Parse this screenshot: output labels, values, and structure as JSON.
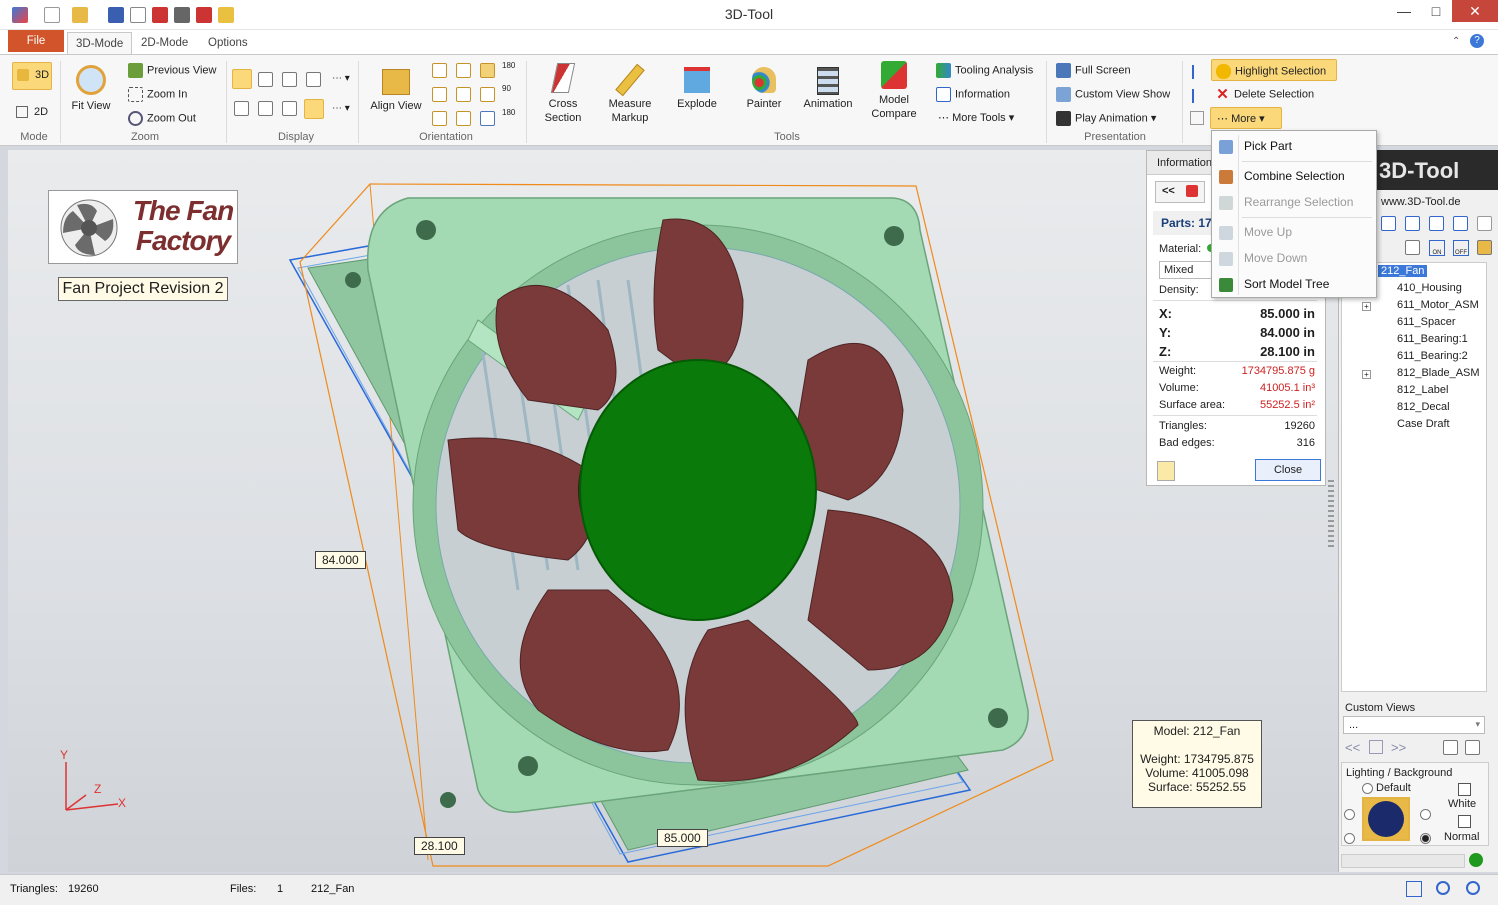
{
  "window": {
    "title": "3D-Tool",
    "min": "—",
    "max": "□",
    "close": "✕"
  },
  "tabs": {
    "file": "File",
    "mode3d": "3D-Mode",
    "mode2d": "2D-Mode",
    "options": "Options"
  },
  "ribbon": {
    "mode": {
      "label": "Mode",
      "btn3d": "3D",
      "btn2d": "2D"
    },
    "zoom": {
      "label": "Zoom",
      "fit_view": "Fit View",
      "previous_view": "Previous View",
      "zoom_in": "Zoom In",
      "zoom_out": "Zoom Out"
    },
    "display": {
      "label": "Display"
    },
    "orientation": {
      "label": "Orientation",
      "align_view": "Align View",
      "rot180a": "180",
      "rot90": "90",
      "rot180b": "180"
    },
    "tools": {
      "label": "Tools",
      "cross_section": "Cross\nSection",
      "cross_section_1": "Cross",
      "cross_section_2": "Section",
      "measure_1": "Measure",
      "measure_2": "Markup",
      "explode": "Explode",
      "painter": "Painter",
      "animation": "Animation",
      "model_compare_1": "Model",
      "model_compare_2": "Compare",
      "tooling_analysis": "Tooling Analysis",
      "information": "Information",
      "more_tools": "More Tools"
    },
    "presentation": {
      "label": "Presentation",
      "full_screen": "Full Screen",
      "custom_view_show": "Custom View Show",
      "play_animation": "Play Animation"
    },
    "selection": {
      "highlight": "Highlight Selection",
      "delete": "Delete Selection",
      "more": "More"
    }
  },
  "dropdown": {
    "items": [
      {
        "label": "Pick Part",
        "enabled": true
      },
      {
        "label": "Combine Selection",
        "enabled": true
      },
      {
        "label": "Rearrange Selection",
        "enabled": false
      },
      {
        "label": "Move Up",
        "enabled": false
      },
      {
        "label": "Move Down",
        "enabled": false
      },
      {
        "label": "Sort Model Tree",
        "enabled": true
      }
    ]
  },
  "viewport": {
    "logo_text": "The Fan Factory",
    "revision": "Fan Project Revision 2",
    "dim_y": "84.000",
    "dim_z": "28.100",
    "dim_x": "85.000",
    "axis_y": "Y",
    "axis_z": "Z",
    "axis_x": "X",
    "model_info": {
      "model": "Model: 212_Fan",
      "weight": "Weight: 1734795.875",
      "volume": "Volume: 41005.098",
      "surface": "Surface: 55252.55"
    }
  },
  "info_panel": {
    "title": "Information",
    "back": "<<",
    "parts": "Parts: 17",
    "material_label": "Material:",
    "material_value": "Mixed mat",
    "density_label": "Density:",
    "x_label": "X:",
    "x_value": "85.000 in",
    "y_label": "Y:",
    "y_value": "84.000 in",
    "z_label": "Z:",
    "z_value": "28.100 in",
    "weight_label": "Weight:",
    "weight_value": "1734795.875 g",
    "volume_label": "Volume:",
    "volume_value": "41005.1 in³",
    "surface_label": "Surface area:",
    "surface_value": "55252.5 in²",
    "triangles_label": "Triangles:",
    "triangles_value": "19260",
    "bad_edges_label": "Bad edges:",
    "bad_edges_value": "316",
    "close": "Close"
  },
  "right_panel": {
    "brand": "3D-Tool",
    "url": "www.3D-Tool.de",
    "on": "ON",
    "off": "OFF",
    "tree_root": "212_Fan",
    "tree_items": [
      "410_Housing",
      "611_Motor_ASM",
      "611_Spacer",
      "611_Bearing:1",
      "611_Bearing:2",
      "812_Blade_ASM",
      "812_Label",
      "812_Decal",
      "Case Draft"
    ],
    "custom_views_label": "Custom Views",
    "custom_views_value": "...",
    "nav_prev": "<<",
    "nav_next": ">>",
    "lighting_label": "Lighting / Background",
    "default_label": "Default",
    "white_label": "White",
    "normal_label": "Normal"
  },
  "status": {
    "triangles_label": "Triangles:",
    "triangles_value": "19260",
    "files_label": "Files:",
    "files_value": "1",
    "model": "212_Fan"
  },
  "colors": {
    "file_tab": "#d2542a",
    "housing": "#9fd5ae",
    "blades": "#7a3a3a",
    "hub": "#0a7a0a",
    "highlight": "#fbd87a"
  }
}
